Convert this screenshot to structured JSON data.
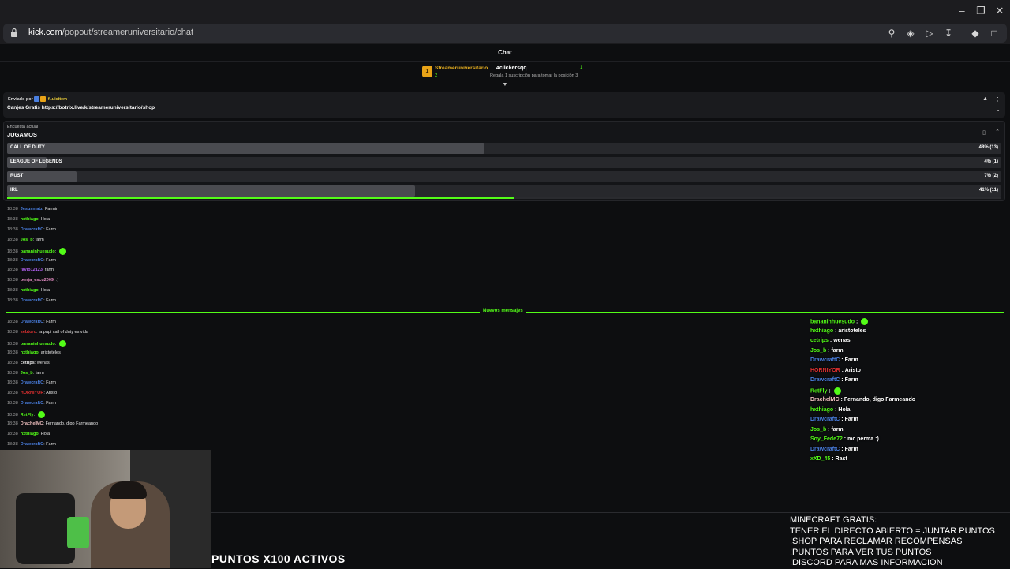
{
  "browser": {
    "url_host": "kick.com",
    "url_path": "/popout/streameruniversitario/chat"
  },
  "chat": {
    "title": "Chat",
    "leaderboard": {
      "rank": "1",
      "first_name": "Streameruniversitario",
      "first_count": "2",
      "second_name": "4clickersqq",
      "second_count": "1",
      "second_sub": "Regala 1 suscripción para tomar la posición 3"
    },
    "pinned": {
      "sent_by": "Enviado por",
      "author": "fi.uisitem",
      "label": "Canjes Gratis",
      "link": "https://botrix.live/k/streameruniversitario/shop"
    },
    "poll": {
      "caption": "Encuesta actual",
      "question": "JUGAMOS",
      "options": [
        {
          "label": "CALL OF DUTY",
          "pct": "48% (13)",
          "fraction": 0.48
        },
        {
          "label": "LEAGUE OF LEGENDS",
          "pct": "4% (1)",
          "fraction": 0.04
        },
        {
          "label": "RUST",
          "pct": "7% (2)",
          "fraction": 0.07
        },
        {
          "label": "IRL",
          "pct": "41% (11)",
          "fraction": 0.41
        }
      ],
      "timer_fraction": 0.51,
      "accent_color": "#53fc18"
    },
    "messages_before": [
      {
        "time": "18:38",
        "user": "Jesusmatz",
        "color": "#4a7fe0",
        "text": "Farmin"
      },
      {
        "time": "18:38",
        "user": "hxthiago",
        "color": "#53fc18",
        "text": "Hola"
      },
      {
        "time": "18:38",
        "user": "DrawcraftC",
        "color": "#4a7fe0",
        "text": "Farm"
      },
      {
        "time": "18:38",
        "user": "Jos_b",
        "color": "#53fc18",
        "text": "farm"
      },
      {
        "time": "18:38",
        "user": "bananinhuesudo",
        "color": "#53fc18",
        "text": ""
      },
      {
        "time": "18:38",
        "user": "DrawcraftC",
        "color": "#4a7fe0",
        "text": "Farm"
      },
      {
        "time": "18:38",
        "user": "favio12123",
        "color": "#b060f0",
        "text": "farm"
      },
      {
        "time": "18:38",
        "user": "benja_escu2009",
        "color": "#e08ac0",
        "text": ":)"
      },
      {
        "time": "18:38",
        "user": "hxthiago",
        "color": "#53fc18",
        "text": "Hola"
      },
      {
        "time": "18:38",
        "user": "DrawcraftC",
        "color": "#4a7fe0",
        "text": "Farm"
      }
    ],
    "new_messages_label": "Nuevos mensajes",
    "messages_after": [
      {
        "time": "18:38",
        "user": "DrawcraftC",
        "color": "#4a7fe0",
        "text": "Farm"
      },
      {
        "time": "18:38",
        "user": "sebtoro",
        "color": "#e03030",
        "text": "la papi call of duty es vida"
      },
      {
        "time": "18:38",
        "user": "bananinhuesudo",
        "color": "#53fc18",
        "text": ""
      },
      {
        "time": "18:38",
        "user": "hxthiago",
        "color": "#53fc18",
        "text": "aristoteles"
      },
      {
        "time": "18:38",
        "user": "cetrips",
        "color": "#e4e4e4",
        "text": "wenas"
      },
      {
        "time": "18:38",
        "user": "Jos_b",
        "color": "#53fc18",
        "text": "farm"
      },
      {
        "time": "18:38",
        "user": "DrawcraftC",
        "color": "#4a7fe0",
        "text": "Farm"
      },
      {
        "time": "18:38",
        "user": "HORNIYOR",
        "color": "#e03030",
        "text": "Aristo"
      },
      {
        "time": "18:38",
        "user": "DrawcraftC",
        "color": "#4a7fe0",
        "text": "Farm"
      },
      {
        "time": "18:38",
        "user": "RetFly",
        "color": "#53fc18",
        "text": ""
      },
      {
        "time": "18:38",
        "user": "DrachelMC",
        "color": "#f0c0c0",
        "text": "Fernando, digo Farmeando"
      },
      {
        "time": "18:38",
        "user": "hxthiago",
        "color": "#53fc18",
        "text": "Hola"
      },
      {
        "time": "18:38",
        "user": "DrawcraftC",
        "color": "#4a7fe0",
        "text": "Farm"
      }
    ]
  },
  "stream_overlay": {
    "chat": [
      {
        "user": "bananinhuesudo",
        "color": "#53fc18",
        "text": ""
      },
      {
        "user": "hxthiago",
        "color": "#53fc18",
        "text": "aristoteles"
      },
      {
        "user": "cetrips",
        "color": "#53fc18",
        "text": "wenas"
      },
      {
        "user": "Jos_b",
        "color": "#53fc18",
        "text": "farm"
      },
      {
        "user": "DrawcraftC",
        "color": "#4a7fe0",
        "text": "Farm"
      },
      {
        "user": "HORNIYOR",
        "color": "#e03030",
        "text": "Aristo"
      },
      {
        "user": "DrawcraftC",
        "color": "#4a7fe0",
        "text": "Farm"
      },
      {
        "user": "RetFly",
        "color": "#53fc18",
        "text": ""
      },
      {
        "user": "DrachelMC",
        "color": "#f0c0c0",
        "text": "Fernando, digo Farmeando"
      },
      {
        "user": "hxthiago",
        "color": "#53fc18",
        "text": "Hola"
      },
      {
        "user": "DrawcraftC",
        "color": "#4a7fe0",
        "text": "Farm"
      },
      {
        "user": "Jos_b",
        "color": "#53fc18",
        "text": "farm"
      },
      {
        "user": "Soy_Fede72",
        "color": "#53fc18",
        "text": "mc perma :)"
      },
      {
        "user": "DrawcraftC",
        "color": "#4a7fe0",
        "text": "Farm"
      },
      {
        "user": "xXD_45",
        "color": "#53fc18",
        "text": "Rast"
      }
    ],
    "points_banner": "PUNTOS X100 ACTIVOS",
    "info_lines": [
      "MINECRAFT GRATIS:",
      "TENER EL DIRECTO ABIERTO = JUNTAR PUNTOS",
      "!SHOP PARA RECLAMAR RECOMPENSAS",
      "!PUNTOS PARA VER TUS PUNTOS",
      "!DISCORD PARA MAS INFORMACION"
    ]
  }
}
